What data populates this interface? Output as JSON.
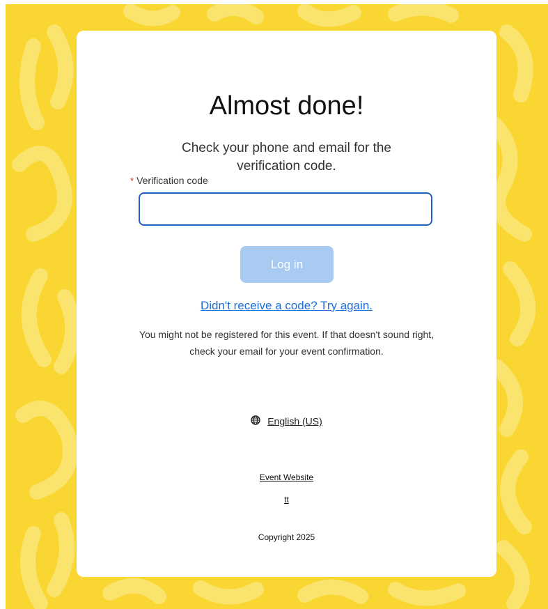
{
  "colors": {
    "background": "#f9d631",
    "pattern": "#fbe46e",
    "card": "#ffffff",
    "input_border": "#1f5fbf",
    "button_disabled": "#a9cbf2",
    "link": "#1a6fd6",
    "required": "#d0312d"
  },
  "login": {
    "title": "Almost done!",
    "subtitle": "Check your phone and email for the verification code.",
    "field_label": "Verification code",
    "required_marker": "*",
    "code_value": "",
    "login_label": "Log in",
    "retry_link": "Didn't receive a code? Try again.",
    "notice": "You might not be registered for this event. If that doesn't sound right, check your email for your event confirmation."
  },
  "language": {
    "icon": "globe-icon",
    "label": "English (US)"
  },
  "footer": {
    "event_website": "Event Website",
    "extra_link": "tt",
    "copyright": "Copyright 2025"
  }
}
